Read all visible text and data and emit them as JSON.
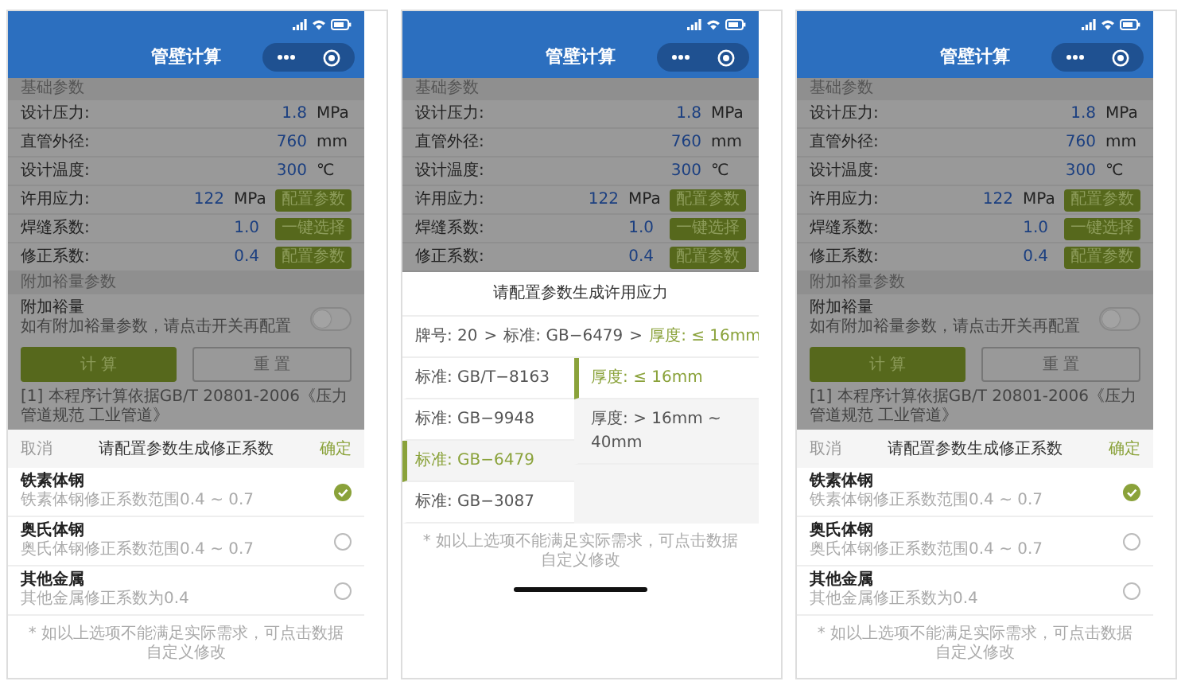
{
  "phones": [
    {
      "kind": "coefficient",
      "title": "管壁计算",
      "basic_section": "基础参数",
      "params": [
        {
          "label": "设计压力:",
          "value": "1.8",
          "unit": "MPa"
        },
        {
          "label": "直管外径:",
          "value": "760",
          "unit": "mm"
        },
        {
          "label": "设计温度:",
          "value": "300",
          "unit": "℃"
        },
        {
          "label": "许用应力:",
          "value": "122",
          "unit": "MPa",
          "action": "配置参数"
        },
        {
          "label": "焊缝系数:",
          "value": "1.0",
          "action": "一键选择"
        },
        {
          "label": "修正系数:",
          "value": "0.4",
          "action": "配置参数"
        }
      ],
      "extra_section": "附加裕量参数",
      "toggle": {
        "label": "附加裕量",
        "description": "如有附加裕量参数，请点击开关再配置",
        "on": false
      },
      "buttons": [
        "计 算",
        "重 置"
      ],
      "note": "[1] 本程序计算依据GB/T 20801-2006《压力管道规范 工业管道》",
      "sheet": {
        "cancel": "取消",
        "title": "请配置参数生成修正系数",
        "confirm": "确定",
        "options": [
          {
            "name": "铁素体钢",
            "description": "铁素体钢修正系数范围0.4 ~ 0.7",
            "selected": true
          },
          {
            "name": "奥氏体钢",
            "description": "奥氏体钢修正系数范围0.4 ~ 0.7",
            "selected": false
          },
          {
            "name": "其他金属",
            "description": "其他金属修正系数为0.4",
            "selected": false
          }
        ],
        "footnote": "* 如以上选项不能满足实际需求，可点击数据自定义修改"
      }
    },
    {
      "kind": "stress",
      "title": "管壁计算",
      "basic_section": "基础参数",
      "params": [
        {
          "label": "设计压力:",
          "value": "1.8",
          "unit": "MPa"
        },
        {
          "label": "直管外径:",
          "value": "760",
          "unit": "mm"
        },
        {
          "label": "设计温度:",
          "value": "300",
          "unit": "℃"
        },
        {
          "label": "许用应力:",
          "value": "122",
          "unit": "MPa",
          "action": "配置参数"
        },
        {
          "label": "焊缝系数:",
          "value": "1.0",
          "action": "一键选择"
        },
        {
          "label": "修正系数:",
          "value": "0.4",
          "action": "配置参数"
        }
      ],
      "sheet": {
        "title": "请配置参数生成许用应力",
        "breadcrumb": [
          {
            "text": "牌号: 20",
            "highlighted": false
          },
          {
            "text": ">",
            "highlighted": false
          },
          {
            "text": "标准: GB−6479",
            "highlighted": false
          },
          {
            "text": ">",
            "highlighted": false
          },
          {
            "text": "厚度: ≤ 16mm",
            "highlighted": true
          }
        ],
        "standards": [
          {
            "text": "标准: GB/T−8163",
            "selected": false
          },
          {
            "text": "标准: GB−9948",
            "selected": false
          },
          {
            "text": "标准: GB−6479",
            "selected": true
          },
          {
            "text": "标准: GB−3087",
            "selected": false
          }
        ],
        "thickness": [
          {
            "text": "厚度: ≤ 16mm",
            "selected": true
          },
          {
            "text": "厚度: > 16mm ~ 40mm",
            "selected": false
          }
        ],
        "footnote": "* 如以上选项不能满足实际需求，可点击数据自定义修改"
      }
    },
    {
      "kind": "coefficient",
      "title": "管壁计算",
      "basic_section": "基础参数",
      "params": [
        {
          "label": "设计压力:",
          "value": "1.8",
          "unit": "MPa"
        },
        {
          "label": "直管外径:",
          "value": "760",
          "unit": "mm"
        },
        {
          "label": "设计温度:",
          "value": "300",
          "unit": "℃"
        },
        {
          "label": "许用应力:",
          "value": "122",
          "unit": "MPa",
          "action": "配置参数"
        },
        {
          "label": "焊缝系数:",
          "value": "1.0",
          "action": "一键选择"
        },
        {
          "label": "修正系数:",
          "value": "0.4",
          "action": "配置参数"
        }
      ],
      "extra_section": "附加裕量参数",
      "toggle": {
        "label": "附加裕量",
        "description": "如有附加裕量参数，请点击开关再配置",
        "on": false
      },
      "buttons": [
        "计 算",
        "重 置"
      ],
      "note": "[1] 本程序计算依据GB/T 20801-2006《压力管道规范 工业管道》",
      "sheet": {
        "cancel": "取消",
        "title": "请配置参数生成修正系数",
        "confirm": "确定",
        "options": [
          {
            "name": "铁素体钢",
            "description": "铁素体钢修正系数范围0.4 ~ 0.7",
            "selected": true
          },
          {
            "name": "奥氏体钢",
            "description": "奥氏体钢修正系数范围0.4 ~ 0.7",
            "selected": false
          },
          {
            "name": "其他金属",
            "description": "其他金属修正系数为0.4",
            "selected": false
          }
        ],
        "footnote": "* 如以上选项不能满足实际需求，可点击数据自定义修改"
      }
    }
  ]
}
